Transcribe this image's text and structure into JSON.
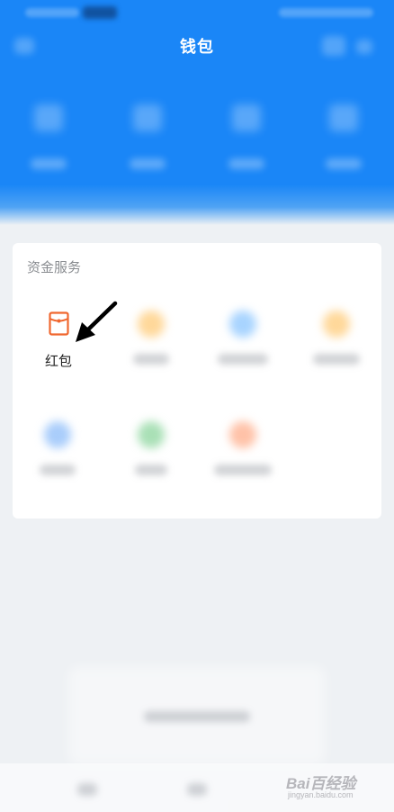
{
  "header": {
    "title": "钱包"
  },
  "section": {
    "title": "资金服务"
  },
  "highlighted_service": {
    "label": "红包",
    "icon": "red-packet-icon",
    "color": "#f0672f"
  },
  "colors": {
    "header_blue": "#1a86f7",
    "arrow": "#000000"
  },
  "watermark": {
    "text": "Bai百经验",
    "sub": "jingyan.baidu.com"
  }
}
